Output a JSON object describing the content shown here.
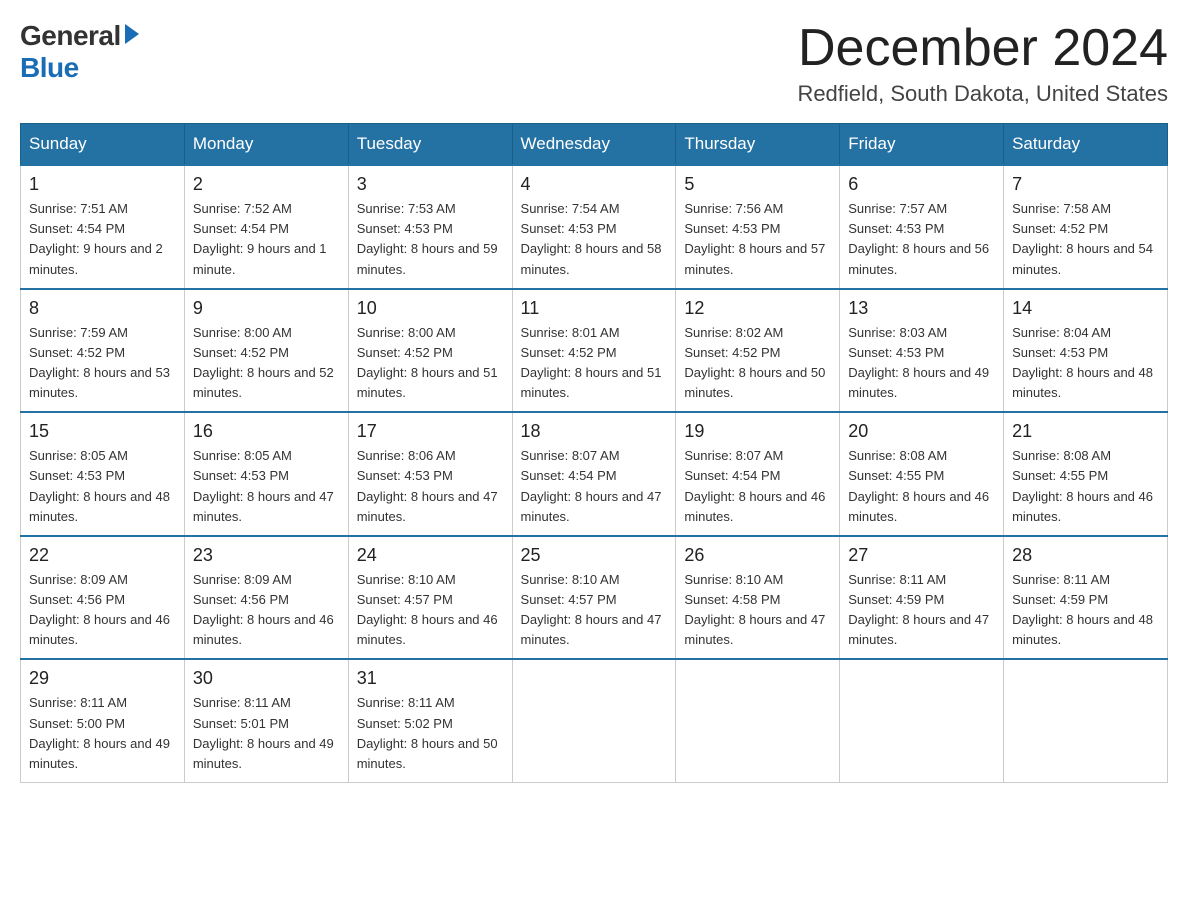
{
  "header": {
    "logo_general": "General",
    "logo_blue": "Blue",
    "month_title": "December 2024",
    "location": "Redfield, South Dakota, United States"
  },
  "weekdays": [
    "Sunday",
    "Monday",
    "Tuesday",
    "Wednesday",
    "Thursday",
    "Friday",
    "Saturday"
  ],
  "weeks": [
    [
      {
        "day": "1",
        "sunrise": "7:51 AM",
        "sunset": "4:54 PM",
        "daylight": "9 hours and 2 minutes."
      },
      {
        "day": "2",
        "sunrise": "7:52 AM",
        "sunset": "4:54 PM",
        "daylight": "9 hours and 1 minute."
      },
      {
        "day": "3",
        "sunrise": "7:53 AM",
        "sunset": "4:53 PM",
        "daylight": "8 hours and 59 minutes."
      },
      {
        "day": "4",
        "sunrise": "7:54 AM",
        "sunset": "4:53 PM",
        "daylight": "8 hours and 58 minutes."
      },
      {
        "day": "5",
        "sunrise": "7:56 AM",
        "sunset": "4:53 PM",
        "daylight": "8 hours and 57 minutes."
      },
      {
        "day": "6",
        "sunrise": "7:57 AM",
        "sunset": "4:53 PM",
        "daylight": "8 hours and 56 minutes."
      },
      {
        "day": "7",
        "sunrise": "7:58 AM",
        "sunset": "4:52 PM",
        "daylight": "8 hours and 54 minutes."
      }
    ],
    [
      {
        "day": "8",
        "sunrise": "7:59 AM",
        "sunset": "4:52 PM",
        "daylight": "8 hours and 53 minutes."
      },
      {
        "day": "9",
        "sunrise": "8:00 AM",
        "sunset": "4:52 PM",
        "daylight": "8 hours and 52 minutes."
      },
      {
        "day": "10",
        "sunrise": "8:00 AM",
        "sunset": "4:52 PM",
        "daylight": "8 hours and 51 minutes."
      },
      {
        "day": "11",
        "sunrise": "8:01 AM",
        "sunset": "4:52 PM",
        "daylight": "8 hours and 51 minutes."
      },
      {
        "day": "12",
        "sunrise": "8:02 AM",
        "sunset": "4:52 PM",
        "daylight": "8 hours and 50 minutes."
      },
      {
        "day": "13",
        "sunrise": "8:03 AM",
        "sunset": "4:53 PM",
        "daylight": "8 hours and 49 minutes."
      },
      {
        "day": "14",
        "sunrise": "8:04 AM",
        "sunset": "4:53 PM",
        "daylight": "8 hours and 48 minutes."
      }
    ],
    [
      {
        "day": "15",
        "sunrise": "8:05 AM",
        "sunset": "4:53 PM",
        "daylight": "8 hours and 48 minutes."
      },
      {
        "day": "16",
        "sunrise": "8:05 AM",
        "sunset": "4:53 PM",
        "daylight": "8 hours and 47 minutes."
      },
      {
        "day": "17",
        "sunrise": "8:06 AM",
        "sunset": "4:53 PM",
        "daylight": "8 hours and 47 minutes."
      },
      {
        "day": "18",
        "sunrise": "8:07 AM",
        "sunset": "4:54 PM",
        "daylight": "8 hours and 47 minutes."
      },
      {
        "day": "19",
        "sunrise": "8:07 AM",
        "sunset": "4:54 PM",
        "daylight": "8 hours and 46 minutes."
      },
      {
        "day": "20",
        "sunrise": "8:08 AM",
        "sunset": "4:55 PM",
        "daylight": "8 hours and 46 minutes."
      },
      {
        "day": "21",
        "sunrise": "8:08 AM",
        "sunset": "4:55 PM",
        "daylight": "8 hours and 46 minutes."
      }
    ],
    [
      {
        "day": "22",
        "sunrise": "8:09 AM",
        "sunset": "4:56 PM",
        "daylight": "8 hours and 46 minutes."
      },
      {
        "day": "23",
        "sunrise": "8:09 AM",
        "sunset": "4:56 PM",
        "daylight": "8 hours and 46 minutes."
      },
      {
        "day": "24",
        "sunrise": "8:10 AM",
        "sunset": "4:57 PM",
        "daylight": "8 hours and 46 minutes."
      },
      {
        "day": "25",
        "sunrise": "8:10 AM",
        "sunset": "4:57 PM",
        "daylight": "8 hours and 47 minutes."
      },
      {
        "day": "26",
        "sunrise": "8:10 AM",
        "sunset": "4:58 PM",
        "daylight": "8 hours and 47 minutes."
      },
      {
        "day": "27",
        "sunrise": "8:11 AM",
        "sunset": "4:59 PM",
        "daylight": "8 hours and 47 minutes."
      },
      {
        "day": "28",
        "sunrise": "8:11 AM",
        "sunset": "4:59 PM",
        "daylight": "8 hours and 48 minutes."
      }
    ],
    [
      {
        "day": "29",
        "sunrise": "8:11 AM",
        "sunset": "5:00 PM",
        "daylight": "8 hours and 49 minutes."
      },
      {
        "day": "30",
        "sunrise": "8:11 AM",
        "sunset": "5:01 PM",
        "daylight": "8 hours and 49 minutes."
      },
      {
        "day": "31",
        "sunrise": "8:11 AM",
        "sunset": "5:02 PM",
        "daylight": "8 hours and 50 minutes."
      },
      null,
      null,
      null,
      null
    ]
  ]
}
